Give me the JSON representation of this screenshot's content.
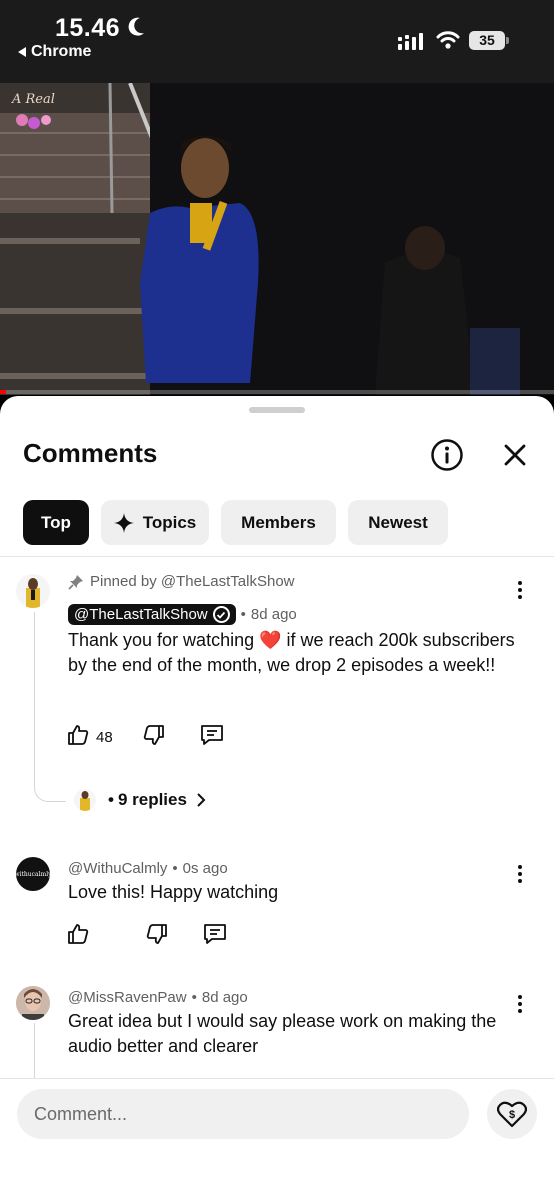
{
  "status_bar": {
    "time": "15.46",
    "back_app": "Chrome",
    "battery": "35"
  },
  "video": {
    "watermark": "A Real",
    "progress_fraction": 0.01
  },
  "sheet": {
    "title": "Comments",
    "chips": [
      {
        "label": "Top",
        "active": true
      },
      {
        "label": "Topics",
        "active": false
      },
      {
        "label": "Members",
        "active": false
      },
      {
        "label": "Newest",
        "active": false
      }
    ]
  },
  "comments": [
    {
      "pinned": "Pinned by @TheLastTalkShow",
      "author": "@TheLastTalkShow",
      "time": "8d ago",
      "text": "Thank you for watching ❤️ if we reach 200k subscribers by the end of the month, we drop 2 episodes a week!!",
      "likes": "48",
      "replies": "9 replies"
    },
    {
      "author": "@WithuCalmly",
      "time": "0s ago",
      "text": "Love this! Happy watching",
      "avatar_text": "withucalmly"
    },
    {
      "author": "@MissRavenPaw",
      "time": "8d ago",
      "text": "Great idea but I would say please work on making the audio better and clearer"
    }
  ],
  "input": {
    "placeholder": "Comment..."
  },
  "icons": {
    "moon": "moon-icon",
    "signal": "cellular-signal-icon",
    "wifi": "wifi-icon",
    "info": "info-icon",
    "close": "close-icon",
    "sparkle": "sparkle-icon",
    "pin": "pin-icon",
    "like": "thumbs-up-icon",
    "dislike": "thumbs-down-icon",
    "reply": "reply-icon",
    "more": "more-vert-icon",
    "chevron": "chevron-right-icon",
    "thanks": "super-thanks-icon"
  },
  "colors": {
    "accent": "#0f0f0f",
    "progress": "#ff0000",
    "chip_bg": "#efefef"
  }
}
